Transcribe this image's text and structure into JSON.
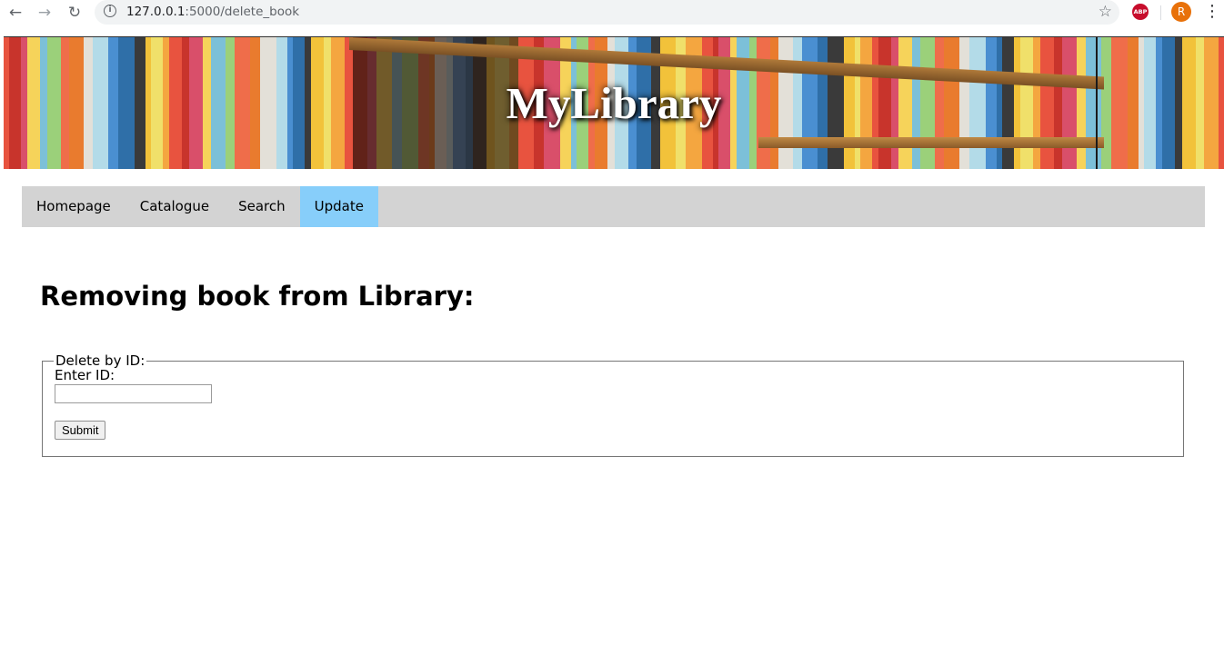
{
  "browser": {
    "url_host": "127.0.0.1",
    "url_rest": ":5000/delete_book",
    "back_icon": "arrow-left-icon",
    "forward_icon": "arrow-right-icon",
    "reload_icon": "reload-icon",
    "abp_label": "ABP",
    "profile_initial": "R"
  },
  "banner": {
    "title": "MyLibrary"
  },
  "nav": {
    "items": [
      {
        "label": "Homepage"
      },
      {
        "label": "Catalogue"
      },
      {
        "label": "Search"
      },
      {
        "label": "Update",
        "active": true
      }
    ],
    "active_color": "#87cefa",
    "bar_color": "#d3d3d3"
  },
  "main": {
    "heading": "Removing book from Library:",
    "fieldset_legend": "Delete by ID:",
    "id_label": "Enter ID:",
    "id_value": "",
    "submit_label": "Submit"
  }
}
